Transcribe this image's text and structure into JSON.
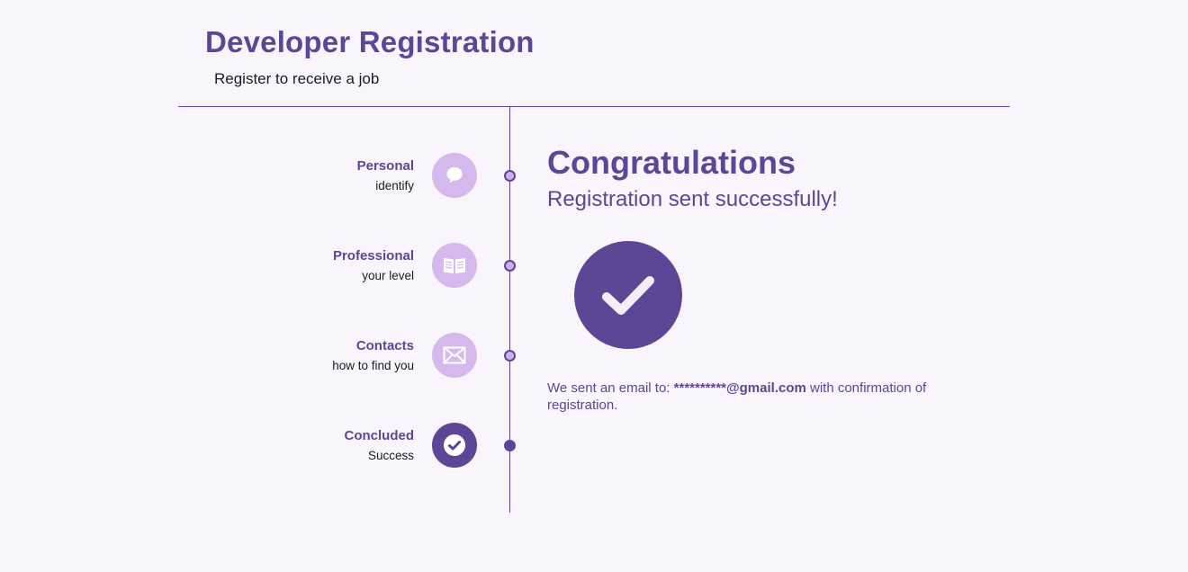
{
  "header": {
    "title": "Developer Registration",
    "subtitle": "Register to receive a job"
  },
  "steps": [
    {
      "title": "Personal",
      "subtitle": "identify",
      "icon": "chat-bubble-icon",
      "active": false
    },
    {
      "title": "Professional",
      "subtitle": "your level",
      "icon": "book-icon",
      "active": false
    },
    {
      "title": "Contacts",
      "subtitle": "how to find you",
      "icon": "envelope-icon",
      "active": false
    },
    {
      "title": "Concluded",
      "subtitle": "Success",
      "icon": "check-circle-icon",
      "active": true
    }
  ],
  "result": {
    "title": "Congratulations",
    "subtitle": "Registration sent successfully!",
    "icon": "checkmark-icon",
    "email_prefix": "We sent an email to:",
    "email": "**********@gmail.com",
    "email_suffix": "with confirmation of registration."
  },
  "colors": {
    "primary": "#5e4696",
    "light": "#d5b8ec",
    "background": "#f8f5fc",
    "text": "#1e1a24"
  }
}
